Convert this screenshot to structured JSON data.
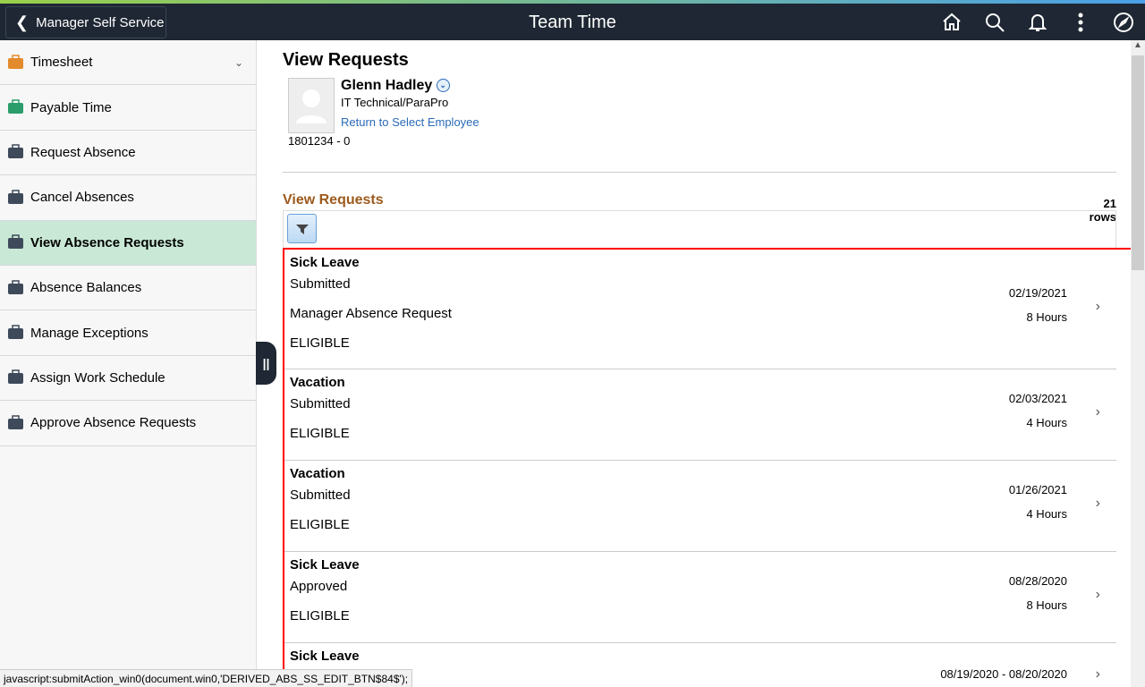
{
  "header": {
    "back_label": "Manager Self Service",
    "title": "Team Time",
    "icons": [
      "home-icon",
      "search-icon",
      "bell-icon",
      "more-icon",
      "compass-icon"
    ]
  },
  "sidebar": {
    "items": [
      {
        "label": "Timesheet",
        "icon": "timesheet-icon",
        "expandable": true
      },
      {
        "label": "Payable Time",
        "icon": "payable-time-icon"
      },
      {
        "label": "Request Absence",
        "icon": "briefcase-icon"
      },
      {
        "label": "Cancel Absences",
        "icon": "briefcase-cancel-icon"
      },
      {
        "label": "View Absence Requests",
        "icon": "briefcase-calendar-icon",
        "active": true
      },
      {
        "label": "Absence Balances",
        "icon": "briefcase-balance-icon"
      },
      {
        "label": "Manage Exceptions",
        "icon": "clock-alert-icon"
      },
      {
        "label": "Assign Work Schedule",
        "icon": "schedule-icon"
      },
      {
        "label": "Approve Absence Requests",
        "icon": "schedule-icon"
      }
    ]
  },
  "page": {
    "title": "View Requests",
    "employee": {
      "name": "Glenn Hadley",
      "job": "IT Technical/ParaPro",
      "return_link": "Return to Select Employee",
      "id": "1801234 - 0"
    },
    "section_title": "View Requests",
    "row_count": "21 rows"
  },
  "requests": [
    {
      "type": "Sick Leave",
      "status": "Submitted",
      "source": "Manager Absence Request",
      "eligibility": "ELIGIBLE",
      "date": "02/19/2021",
      "duration": "8 Hours"
    },
    {
      "type": "Vacation",
      "status": "Submitted",
      "eligibility": "ELIGIBLE",
      "date": "02/03/2021",
      "duration": "4 Hours"
    },
    {
      "type": "Vacation",
      "status": "Submitted",
      "eligibility": "ELIGIBLE",
      "date": "01/26/2021",
      "duration": "4 Hours"
    },
    {
      "type": "Sick Leave",
      "status": "Approved",
      "eligibility": "ELIGIBLE",
      "date": "08/28/2020",
      "duration": "8 Hours"
    },
    {
      "type": "Sick Leave",
      "date": "08/19/2020 - 08/20/2020"
    }
  ],
  "status_bar": "javascript:submitAction_win0(document.win0,'DERIVED_ABS_SS_EDIT_BTN$84$');",
  "colors": {
    "header": "#1e2733",
    "active_item": "#c9e9d6",
    "section_title": "#9c5a1c",
    "link": "#2a6ab8",
    "highlight_border": "#ff0000"
  }
}
